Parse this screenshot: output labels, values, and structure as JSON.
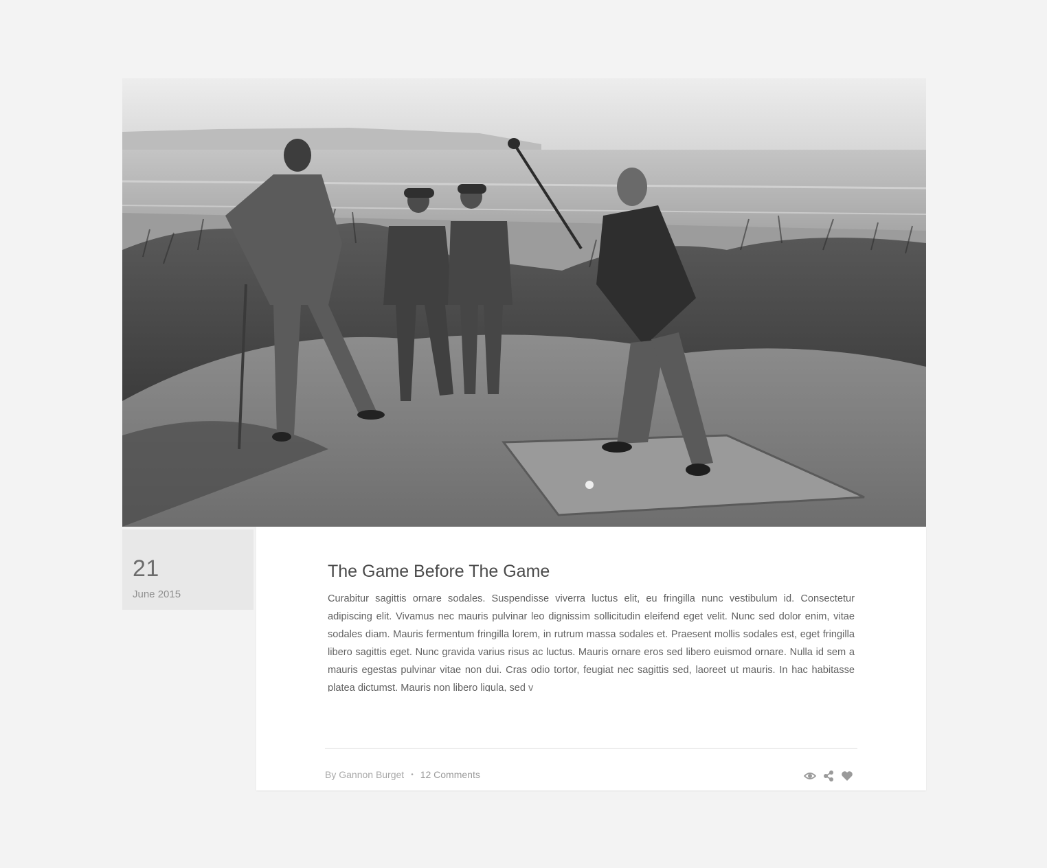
{
  "post": {
    "image": {
      "alt": "Black and white photograph of golfers on sand dunes by the sea",
      "icon": "photo"
    },
    "date": {
      "day": "21",
      "month_year": "June 2015"
    },
    "title": "The Game Before The Game",
    "excerpt": "Curabitur sagittis ornare sodales. Suspendisse viverra luctus elit, eu fringilla nunc vestibulum id. Consectetur adipiscing elit. Vivamus nec mauris pulvinar leo dignissim sollicitudin eleifend eget velit. Nunc sed dolor enim, vitae sodales diam. Mauris fermentum fringilla lorem, in rutrum massa sodales et. Praesent mollis sodales est, eget fringilla libero sagittis eget. Nunc gravida varius risus ac luctus. Mauris ornare eros sed libero euismod ornare. Nulla id sem a mauris egestas pulvinar vitae non dui. Cras odio tortor, feugiat nec sagittis sed, laoreet ut mauris. In hac habitasse platea dictumst. Mauris non libero ligula, sed v",
    "author": "By Gannon Burget",
    "separator": "•",
    "comments": "12 Comments",
    "actions": [
      {
        "name": "views",
        "icon": "eye-icon"
      },
      {
        "name": "share",
        "icon": "share-icon"
      },
      {
        "name": "like",
        "icon": "heart-icon"
      }
    ]
  },
  "colors": {
    "background": "#f3f3f3",
    "card": "#ffffff",
    "date_box": "#e8e8e8",
    "title": "#4a4a4a",
    "body_text": "#616161",
    "meta_text": "#a8a8a8",
    "icon": "#9a9a9a"
  }
}
